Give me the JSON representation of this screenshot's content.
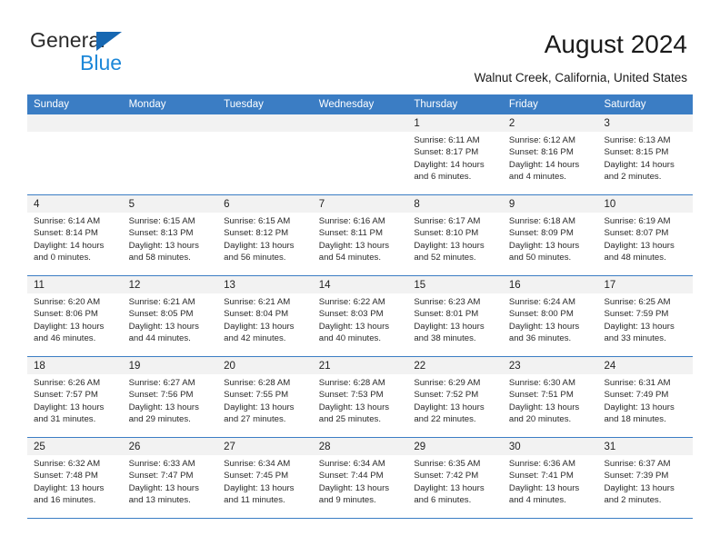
{
  "brand": {
    "name_part1": "General",
    "name_part2": "Blue",
    "logo_icon": "triangle-flag-icon",
    "color_dark": "#2b2b2b",
    "color_blue": "#1c87d8",
    "color_triangle": "#1667b2"
  },
  "header": {
    "month_title": "August 2024",
    "location": "Walnut Creek, California, United States"
  },
  "theme": {
    "header_row_bg": "#3b7dc4",
    "header_row_text": "#ffffff",
    "daynum_band_bg": "#f2f2f2",
    "grid_line": "#3b7dc4"
  },
  "calendar": {
    "day_headers": [
      "Sunday",
      "Monday",
      "Tuesday",
      "Wednesday",
      "Thursday",
      "Friday",
      "Saturday"
    ],
    "weeks": [
      [
        {
          "day": "",
          "empty": true,
          "sunrise": "",
          "sunset": "",
          "daylight_line1": "",
          "daylight_line2": ""
        },
        {
          "day": "",
          "empty": true,
          "sunrise": "",
          "sunset": "",
          "daylight_line1": "",
          "daylight_line2": ""
        },
        {
          "day": "",
          "empty": true,
          "sunrise": "",
          "sunset": "",
          "daylight_line1": "",
          "daylight_line2": ""
        },
        {
          "day": "",
          "empty": true,
          "sunrise": "",
          "sunset": "",
          "daylight_line1": "",
          "daylight_line2": ""
        },
        {
          "day": "1",
          "sunrise": "Sunrise: 6:11 AM",
          "sunset": "Sunset: 8:17 PM",
          "daylight_line1": "Daylight: 14 hours",
          "daylight_line2": "and 6 minutes."
        },
        {
          "day": "2",
          "sunrise": "Sunrise: 6:12 AM",
          "sunset": "Sunset: 8:16 PM",
          "daylight_line1": "Daylight: 14 hours",
          "daylight_line2": "and 4 minutes."
        },
        {
          "day": "3",
          "sunrise": "Sunrise: 6:13 AM",
          "sunset": "Sunset: 8:15 PM",
          "daylight_line1": "Daylight: 14 hours",
          "daylight_line2": "and 2 minutes."
        }
      ],
      [
        {
          "day": "4",
          "sunrise": "Sunrise: 6:14 AM",
          "sunset": "Sunset: 8:14 PM",
          "daylight_line1": "Daylight: 14 hours",
          "daylight_line2": "and 0 minutes."
        },
        {
          "day": "5",
          "sunrise": "Sunrise: 6:15 AM",
          "sunset": "Sunset: 8:13 PM",
          "daylight_line1": "Daylight: 13 hours",
          "daylight_line2": "and 58 minutes."
        },
        {
          "day": "6",
          "sunrise": "Sunrise: 6:15 AM",
          "sunset": "Sunset: 8:12 PM",
          "daylight_line1": "Daylight: 13 hours",
          "daylight_line2": "and 56 minutes."
        },
        {
          "day": "7",
          "sunrise": "Sunrise: 6:16 AM",
          "sunset": "Sunset: 8:11 PM",
          "daylight_line1": "Daylight: 13 hours",
          "daylight_line2": "and 54 minutes."
        },
        {
          "day": "8",
          "sunrise": "Sunrise: 6:17 AM",
          "sunset": "Sunset: 8:10 PM",
          "daylight_line1": "Daylight: 13 hours",
          "daylight_line2": "and 52 minutes."
        },
        {
          "day": "9",
          "sunrise": "Sunrise: 6:18 AM",
          "sunset": "Sunset: 8:09 PM",
          "daylight_line1": "Daylight: 13 hours",
          "daylight_line2": "and 50 minutes."
        },
        {
          "day": "10",
          "sunrise": "Sunrise: 6:19 AM",
          "sunset": "Sunset: 8:07 PM",
          "daylight_line1": "Daylight: 13 hours",
          "daylight_line2": "and 48 minutes."
        }
      ],
      [
        {
          "day": "11",
          "sunrise": "Sunrise: 6:20 AM",
          "sunset": "Sunset: 8:06 PM",
          "daylight_line1": "Daylight: 13 hours",
          "daylight_line2": "and 46 minutes."
        },
        {
          "day": "12",
          "sunrise": "Sunrise: 6:21 AM",
          "sunset": "Sunset: 8:05 PM",
          "daylight_line1": "Daylight: 13 hours",
          "daylight_line2": "and 44 minutes."
        },
        {
          "day": "13",
          "sunrise": "Sunrise: 6:21 AM",
          "sunset": "Sunset: 8:04 PM",
          "daylight_line1": "Daylight: 13 hours",
          "daylight_line2": "and 42 minutes."
        },
        {
          "day": "14",
          "sunrise": "Sunrise: 6:22 AM",
          "sunset": "Sunset: 8:03 PM",
          "daylight_line1": "Daylight: 13 hours",
          "daylight_line2": "and 40 minutes."
        },
        {
          "day": "15",
          "sunrise": "Sunrise: 6:23 AM",
          "sunset": "Sunset: 8:01 PM",
          "daylight_line1": "Daylight: 13 hours",
          "daylight_line2": "and 38 minutes."
        },
        {
          "day": "16",
          "sunrise": "Sunrise: 6:24 AM",
          "sunset": "Sunset: 8:00 PM",
          "daylight_line1": "Daylight: 13 hours",
          "daylight_line2": "and 36 minutes."
        },
        {
          "day": "17",
          "sunrise": "Sunrise: 6:25 AM",
          "sunset": "Sunset: 7:59 PM",
          "daylight_line1": "Daylight: 13 hours",
          "daylight_line2": "and 33 minutes."
        }
      ],
      [
        {
          "day": "18",
          "sunrise": "Sunrise: 6:26 AM",
          "sunset": "Sunset: 7:57 PM",
          "daylight_line1": "Daylight: 13 hours",
          "daylight_line2": "and 31 minutes."
        },
        {
          "day": "19",
          "sunrise": "Sunrise: 6:27 AM",
          "sunset": "Sunset: 7:56 PM",
          "daylight_line1": "Daylight: 13 hours",
          "daylight_line2": "and 29 minutes."
        },
        {
          "day": "20",
          "sunrise": "Sunrise: 6:28 AM",
          "sunset": "Sunset: 7:55 PM",
          "daylight_line1": "Daylight: 13 hours",
          "daylight_line2": "and 27 minutes."
        },
        {
          "day": "21",
          "sunrise": "Sunrise: 6:28 AM",
          "sunset": "Sunset: 7:53 PM",
          "daylight_line1": "Daylight: 13 hours",
          "daylight_line2": "and 25 minutes."
        },
        {
          "day": "22",
          "sunrise": "Sunrise: 6:29 AM",
          "sunset": "Sunset: 7:52 PM",
          "daylight_line1": "Daylight: 13 hours",
          "daylight_line2": "and 22 minutes."
        },
        {
          "day": "23",
          "sunrise": "Sunrise: 6:30 AM",
          "sunset": "Sunset: 7:51 PM",
          "daylight_line1": "Daylight: 13 hours",
          "daylight_line2": "and 20 minutes."
        },
        {
          "day": "24",
          "sunrise": "Sunrise: 6:31 AM",
          "sunset": "Sunset: 7:49 PM",
          "daylight_line1": "Daylight: 13 hours",
          "daylight_line2": "and 18 minutes."
        }
      ],
      [
        {
          "day": "25",
          "sunrise": "Sunrise: 6:32 AM",
          "sunset": "Sunset: 7:48 PM",
          "daylight_line1": "Daylight: 13 hours",
          "daylight_line2": "and 16 minutes."
        },
        {
          "day": "26",
          "sunrise": "Sunrise: 6:33 AM",
          "sunset": "Sunset: 7:47 PM",
          "daylight_line1": "Daylight: 13 hours",
          "daylight_line2": "and 13 minutes."
        },
        {
          "day": "27",
          "sunrise": "Sunrise: 6:34 AM",
          "sunset": "Sunset: 7:45 PM",
          "daylight_line1": "Daylight: 13 hours",
          "daylight_line2": "and 11 minutes."
        },
        {
          "day": "28",
          "sunrise": "Sunrise: 6:34 AM",
          "sunset": "Sunset: 7:44 PM",
          "daylight_line1": "Daylight: 13 hours",
          "daylight_line2": "and 9 minutes."
        },
        {
          "day": "29",
          "sunrise": "Sunrise: 6:35 AM",
          "sunset": "Sunset: 7:42 PM",
          "daylight_line1": "Daylight: 13 hours",
          "daylight_line2": "and 6 minutes."
        },
        {
          "day": "30",
          "sunrise": "Sunrise: 6:36 AM",
          "sunset": "Sunset: 7:41 PM",
          "daylight_line1": "Daylight: 13 hours",
          "daylight_line2": "and 4 minutes."
        },
        {
          "day": "31",
          "sunrise": "Sunrise: 6:37 AM",
          "sunset": "Sunset: 7:39 PM",
          "daylight_line1": "Daylight: 13 hours",
          "daylight_line2": "and 2 minutes."
        }
      ]
    ]
  }
}
